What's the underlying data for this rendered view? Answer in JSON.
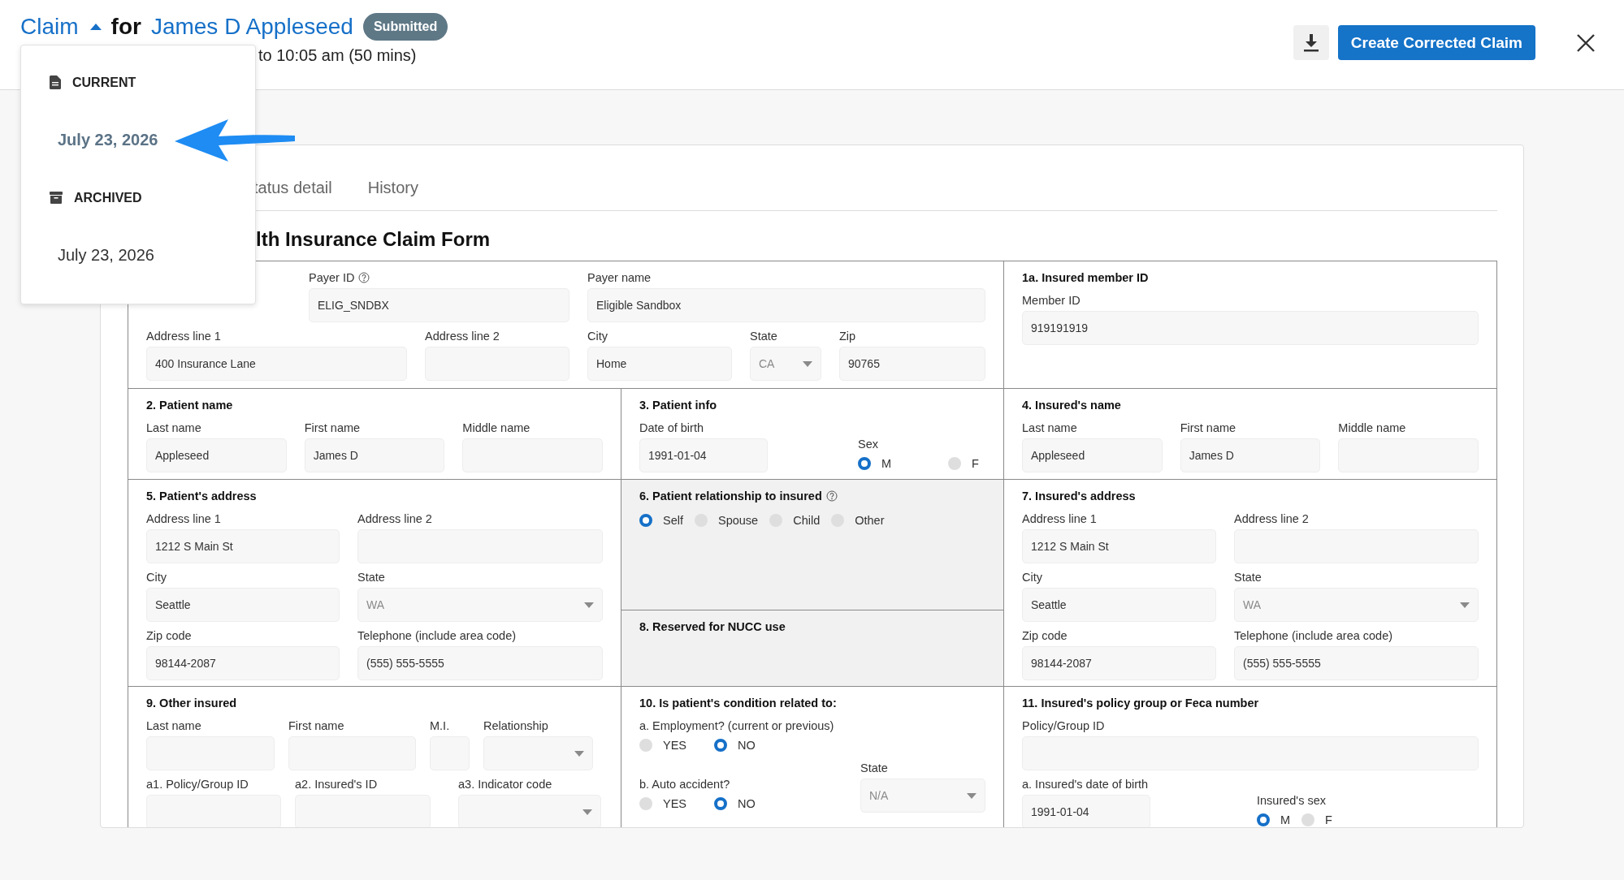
{
  "header": {
    "title": "Claim",
    "expanded": true,
    "connector": "for",
    "patient": "James D Appleseed",
    "status": "Submitted",
    "subtitle": "to 10:05 am (50 mins)",
    "primary_button": "Create Corrected Claim"
  },
  "version_menu": {
    "groups": [
      {
        "kind": "current",
        "label": "CURRENT",
        "items": [
          {
            "label": "July 23, 2026",
            "selected": true
          }
        ]
      },
      {
        "kind": "archived",
        "label": "ARCHIVED",
        "items": [
          {
            "label": "July 23, 2026",
            "selected": false
          }
        ]
      }
    ]
  },
  "tabs": [
    {
      "label": "tatus detail",
      "selected": false
    },
    {
      "label": "History",
      "selected": false
    }
  ],
  "form": {
    "title": "lth Insurance Claim Form",
    "sections": [
      {
        "disabled": false,
        "rows": [
          [
            "",
            {
              "kind": "text",
              "label": "Payer ID",
              "help": true,
              "value": "ELIG_SNDBX"
            },
            {
              "kind": "text",
              "label": "Payer name",
              "value": "Eligible Sandbox"
            }
          ],
          [
            {
              "kind": "text",
              "label": "Address line 1",
              "value": "400 Insurance Lane"
            },
            {
              "kind": "text",
              "label": "Address line 2"
            },
            {
              "kind": "text",
              "label": "City",
              "value": "Home"
            },
            {
              "kind": "select",
              "label": "State",
              "value": "CA",
              "disabled": true
            },
            {
              "kind": "text",
              "label": "Zip",
              "value": "90765"
            }
          ]
        ]
      },
      {
        "disabled": false,
        "heading": "1a. Insured member ID",
        "rows": [
          [
            {
              "kind": "text",
              "label": "Member ID",
              "value": "919191919"
            }
          ]
        ]
      },
      {
        "disabled": false,
        "heading": "2. Patient name",
        "rows": [
          [
            {
              "kind": "text",
              "label": "Last name",
              "value": "Appleseed"
            },
            {
              "kind": "text",
              "label": "First name",
              "value": "James D"
            },
            {
              "kind": "text",
              "label": "Middle name"
            }
          ]
        ]
      },
      {
        "disabled": false,
        "heading": "3. Patient info",
        "rows": [
          [
            {
              "kind": "text",
              "label": "Date of birth",
              "value": "1991-01-04"
            },
            {
              "kind": "radio",
              "label": "Sex",
              "options": [
                {
                  "label": "M",
                  "selected": true
                },
                {
                  "label": "F",
                  "selected": false
                }
              ]
            }
          ]
        ]
      },
      {
        "disabled": false,
        "heading": "4. Insured's name",
        "rows": [
          [
            {
              "kind": "text",
              "label": "Last name",
              "value": "Appleseed"
            },
            {
              "kind": "text",
              "label": "First name",
              "value": "James D"
            },
            {
              "kind": "text",
              "label": "Middle name"
            }
          ]
        ]
      },
      {
        "disabled": false,
        "heading": "5. Patient's address",
        "rows": [
          [
            {
              "kind": "text",
              "label": "Address line 1",
              "value": "1212 S Main St"
            },
            {
              "kind": "text",
              "label": "Address line 2"
            }
          ],
          [
            {
              "kind": "text",
              "label": "City",
              "value": "Seattle"
            },
            {
              "kind": "select",
              "label": "State",
              "value": "WA",
              "disabled": true
            }
          ],
          [
            {
              "kind": "text",
              "label": "Zip code",
              "value": "98144-2087"
            },
            {
              "kind": "text",
              "label": "Telephone (include area code)",
              "value": "(555) 555-5555"
            }
          ]
        ]
      },
      {
        "disabled": true,
        "heading": "6. Patient relationship to insured",
        "help": true,
        "rows": [
          [
            {
              "kind": "radio",
              "options": [
                {
                  "label": "Self",
                  "selected": true
                },
                {
                  "label": "Spouse",
                  "selected": false
                },
                {
                  "label": "Child",
                  "selected": false
                },
                {
                  "label": "Other",
                  "selected": false
                }
              ]
            }
          ]
        ]
      },
      {
        "disabled": false,
        "heading": "7. Insured's address",
        "rows": [
          [
            {
              "kind": "text",
              "label": "Address line 1",
              "value": "1212 S Main St"
            },
            {
              "kind": "text",
              "label": "Address line 2"
            }
          ],
          [
            {
              "kind": "text",
              "label": "City",
              "value": "Seattle"
            },
            {
              "kind": "select",
              "label": "State",
              "value": "WA",
              "disabled": true
            }
          ],
          [
            {
              "kind": "text",
              "label": "Zip code",
              "value": "98144-2087"
            },
            {
              "kind": "text",
              "label": "Telephone (include area code)",
              "value": "(555) 555-5555"
            }
          ]
        ]
      },
      {
        "disabled": true,
        "heading": "8. Reserved for NUCC use"
      },
      {
        "disabled": false,
        "heading": "9. Other insured",
        "rows": [
          [
            {
              "kind": "text",
              "label": "Last name"
            },
            {
              "kind": "text",
              "label": "First name"
            },
            {
              "kind": "text",
              "label": "M.I."
            },
            {
              "kind": "select",
              "label": "Relationship",
              "disabled": true
            }
          ],
          [
            {
              "kind": "text",
              "label": "a1. Policy/Group ID"
            },
            {
              "kind": "text",
              "label": "a2. Insured's ID"
            },
            "",
            {
              "kind": "select",
              "label": "a3. Indicator code",
              "disabled": true
            }
          ]
        ]
      },
      {
        "disabled": false,
        "heading": "10. Is patient's condition related to:",
        "rows": [
          [
            {
              "kind": "radio",
              "label": "a. Employment? (current or previous)",
              "options": [
                {
                  "label": "YES",
                  "selected": false
                },
                {
                  "label": "NO",
                  "selected": true
                }
              ]
            }
          ],
          [
            {
              "kind": "radio",
              "label": "b. Auto accident?",
              "options": [
                {
                  "label": "YES",
                  "selected": false
                },
                {
                  "label": "NO",
                  "selected": true
                }
              ]
            },
            {
              "kind": "select",
              "label": "State",
              "value": "N/A",
              "disabled": true
            }
          ]
        ]
      },
      {
        "disabled": false,
        "heading": "11. Insured's policy group or Feca number",
        "rows": [
          [
            {
              "kind": "text",
              "label": "Policy/Group ID"
            }
          ],
          [
            {
              "kind": "text",
              "label": "a. Insured's date of birth",
              "value": "1991-01-04"
            },
            {
              "kind": "radio",
              "label": "Insured's sex",
              "options": [
                {
                  "label": "M",
                  "selected": true
                },
                {
                  "label": "F",
                  "selected": false
                }
              ]
            }
          ]
        ]
      }
    ]
  }
}
